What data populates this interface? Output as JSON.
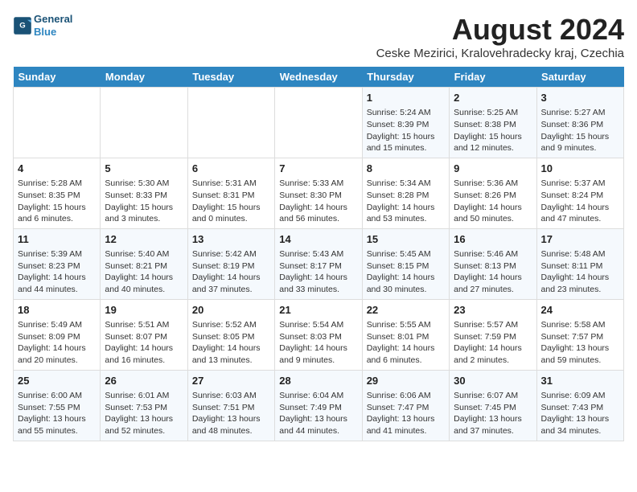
{
  "header": {
    "logo_line1": "General",
    "logo_line2": "Blue",
    "title": "August 2024",
    "subtitle": "Ceske Mezirici, Kralovehradecky kraj, Czechia"
  },
  "days_of_week": [
    "Sunday",
    "Monday",
    "Tuesday",
    "Wednesday",
    "Thursday",
    "Friday",
    "Saturday"
  ],
  "weeks": [
    [
      {
        "day": "",
        "info": ""
      },
      {
        "day": "",
        "info": ""
      },
      {
        "day": "",
        "info": ""
      },
      {
        "day": "",
        "info": ""
      },
      {
        "day": "1",
        "info": "Sunrise: 5:24 AM\nSunset: 8:39 PM\nDaylight: 15 hours\nand 15 minutes."
      },
      {
        "day": "2",
        "info": "Sunrise: 5:25 AM\nSunset: 8:38 PM\nDaylight: 15 hours\nand 12 minutes."
      },
      {
        "day": "3",
        "info": "Sunrise: 5:27 AM\nSunset: 8:36 PM\nDaylight: 15 hours\nand 9 minutes."
      }
    ],
    [
      {
        "day": "4",
        "info": "Sunrise: 5:28 AM\nSunset: 8:35 PM\nDaylight: 15 hours\nand 6 minutes."
      },
      {
        "day": "5",
        "info": "Sunrise: 5:30 AM\nSunset: 8:33 PM\nDaylight: 15 hours\nand 3 minutes."
      },
      {
        "day": "6",
        "info": "Sunrise: 5:31 AM\nSunset: 8:31 PM\nDaylight: 15 hours\nand 0 minutes."
      },
      {
        "day": "7",
        "info": "Sunrise: 5:33 AM\nSunset: 8:30 PM\nDaylight: 14 hours\nand 56 minutes."
      },
      {
        "day": "8",
        "info": "Sunrise: 5:34 AM\nSunset: 8:28 PM\nDaylight: 14 hours\nand 53 minutes."
      },
      {
        "day": "9",
        "info": "Sunrise: 5:36 AM\nSunset: 8:26 PM\nDaylight: 14 hours\nand 50 minutes."
      },
      {
        "day": "10",
        "info": "Sunrise: 5:37 AM\nSunset: 8:24 PM\nDaylight: 14 hours\nand 47 minutes."
      }
    ],
    [
      {
        "day": "11",
        "info": "Sunrise: 5:39 AM\nSunset: 8:23 PM\nDaylight: 14 hours\nand 44 minutes."
      },
      {
        "day": "12",
        "info": "Sunrise: 5:40 AM\nSunset: 8:21 PM\nDaylight: 14 hours\nand 40 minutes."
      },
      {
        "day": "13",
        "info": "Sunrise: 5:42 AM\nSunset: 8:19 PM\nDaylight: 14 hours\nand 37 minutes."
      },
      {
        "day": "14",
        "info": "Sunrise: 5:43 AM\nSunset: 8:17 PM\nDaylight: 14 hours\nand 33 minutes."
      },
      {
        "day": "15",
        "info": "Sunrise: 5:45 AM\nSunset: 8:15 PM\nDaylight: 14 hours\nand 30 minutes."
      },
      {
        "day": "16",
        "info": "Sunrise: 5:46 AM\nSunset: 8:13 PM\nDaylight: 14 hours\nand 27 minutes."
      },
      {
        "day": "17",
        "info": "Sunrise: 5:48 AM\nSunset: 8:11 PM\nDaylight: 14 hours\nand 23 minutes."
      }
    ],
    [
      {
        "day": "18",
        "info": "Sunrise: 5:49 AM\nSunset: 8:09 PM\nDaylight: 14 hours\nand 20 minutes."
      },
      {
        "day": "19",
        "info": "Sunrise: 5:51 AM\nSunset: 8:07 PM\nDaylight: 14 hours\nand 16 minutes."
      },
      {
        "day": "20",
        "info": "Sunrise: 5:52 AM\nSunset: 8:05 PM\nDaylight: 14 hours\nand 13 minutes."
      },
      {
        "day": "21",
        "info": "Sunrise: 5:54 AM\nSunset: 8:03 PM\nDaylight: 14 hours\nand 9 minutes."
      },
      {
        "day": "22",
        "info": "Sunrise: 5:55 AM\nSunset: 8:01 PM\nDaylight: 14 hours\nand 6 minutes."
      },
      {
        "day": "23",
        "info": "Sunrise: 5:57 AM\nSunset: 7:59 PM\nDaylight: 14 hours\nand 2 minutes."
      },
      {
        "day": "24",
        "info": "Sunrise: 5:58 AM\nSunset: 7:57 PM\nDaylight: 13 hours\nand 59 minutes."
      }
    ],
    [
      {
        "day": "25",
        "info": "Sunrise: 6:00 AM\nSunset: 7:55 PM\nDaylight: 13 hours\nand 55 minutes."
      },
      {
        "day": "26",
        "info": "Sunrise: 6:01 AM\nSunset: 7:53 PM\nDaylight: 13 hours\nand 52 minutes."
      },
      {
        "day": "27",
        "info": "Sunrise: 6:03 AM\nSunset: 7:51 PM\nDaylight: 13 hours\nand 48 minutes."
      },
      {
        "day": "28",
        "info": "Sunrise: 6:04 AM\nSunset: 7:49 PM\nDaylight: 13 hours\nand 44 minutes."
      },
      {
        "day": "29",
        "info": "Sunrise: 6:06 AM\nSunset: 7:47 PM\nDaylight: 13 hours\nand 41 minutes."
      },
      {
        "day": "30",
        "info": "Sunrise: 6:07 AM\nSunset: 7:45 PM\nDaylight: 13 hours\nand 37 minutes."
      },
      {
        "day": "31",
        "info": "Sunrise: 6:09 AM\nSunset: 7:43 PM\nDaylight: 13 hours\nand 34 minutes."
      }
    ]
  ]
}
